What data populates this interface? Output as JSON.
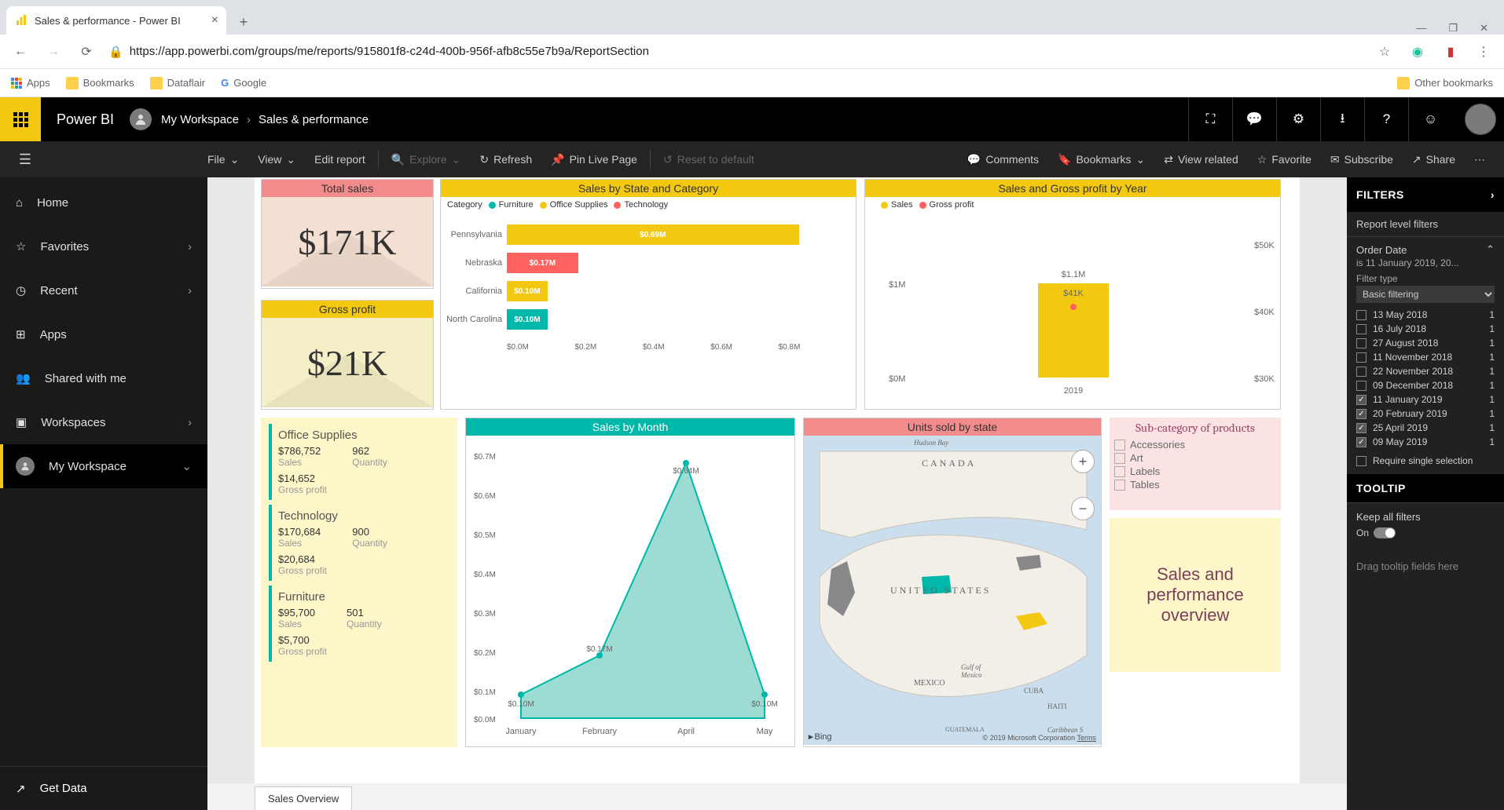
{
  "browser": {
    "tab_title": "Sales & performance - Power BI",
    "url": "https://app.powerbi.com/groups/me/reports/915801f8-c24d-400b-956f-afb8c55e7b9a/ReportSection",
    "bookmarks": [
      "Apps",
      "Bookmarks",
      "Dataflair",
      "Google"
    ],
    "other_bookmarks": "Other bookmarks"
  },
  "pbi": {
    "brand": "Power BI",
    "crumb_ws": "My Workspace",
    "crumb_report": "Sales & performance"
  },
  "toolbar": {
    "file": "File",
    "view": "View",
    "edit": "Edit report",
    "explore": "Explore",
    "refresh": "Refresh",
    "pin": "Pin Live Page",
    "reset": "Reset to default",
    "comments": "Comments",
    "bookmarks": "Bookmarks",
    "related": "View related",
    "favorite": "Favorite",
    "subscribe": "Subscribe",
    "share": "Share"
  },
  "sidebar": {
    "items": [
      "Home",
      "Favorites",
      "Recent",
      "Apps",
      "Shared with me",
      "Workspaces",
      "My Workspace"
    ],
    "get_data": "Get Data"
  },
  "visuals": {
    "total_sales": {
      "title": "Total sales",
      "value": "$171K"
    },
    "gross_profit": {
      "title": "Gross profit",
      "value": "$21K"
    },
    "sales_state_cat": {
      "title": "Sales by State and Category",
      "legend_label": "Category",
      "legend": [
        "Furniture",
        "Office Supplies",
        "Technology"
      ]
    },
    "sales_profit_year": {
      "title": "Sales and Gross profit by Year",
      "legend": [
        "Sales",
        "Gross profit"
      ]
    },
    "multirow": {
      "groups": [
        {
          "name": "Office Supplies",
          "sales": "$786,752",
          "qty": "962",
          "gp": "$14,652"
        },
        {
          "name": "Technology",
          "sales": "$170,684",
          "qty": "900",
          "gp": "$20,684"
        },
        {
          "name": "Furniture",
          "sales": "$95,700",
          "qty": "501",
          "gp": "$5,700"
        }
      ],
      "labels": {
        "sales": "Sales",
        "qty": "Quantity",
        "gp": "Gross profit"
      }
    },
    "sales_month": {
      "title": "Sales by Month"
    },
    "units_state": {
      "title": "Units sold by state",
      "canada": "CANADA",
      "us": "UNITED STATES",
      "mexico": "MEXICO",
      "gulf": "Gulf of\nMexico",
      "bing": "Bing",
      "copyright": "© 2019 Microsoft Corporation",
      "terms": "Terms",
      "hudson": "Hudson Bay",
      "cuba": "CUBA",
      "haiti": "HAITI",
      "guat": "GUATEMALA",
      "carib": "Caribbean S"
    },
    "subcat": {
      "title": "Sub-category of products",
      "items": [
        "Accessories",
        "Art",
        "Labels",
        "Tables"
      ]
    },
    "overview": {
      "line1": "Sales and",
      "line2": "performance",
      "line3": "overview"
    }
  },
  "report_tab": "Sales Overview",
  "filters": {
    "header": "FILTERS",
    "level": "Report level filters",
    "order_date": "Order Date",
    "order_date_sub": "is 11 January 2019, 20...",
    "filter_type_lbl": "Filter type",
    "filter_type": "Basic filtering",
    "dates": [
      {
        "d": "13 May 2018",
        "c": "1",
        "checked": false
      },
      {
        "d": "16 July 2018",
        "c": "1",
        "checked": false
      },
      {
        "d": "27 August 2018",
        "c": "1",
        "checked": false
      },
      {
        "d": "11 November 2018",
        "c": "1",
        "checked": false
      },
      {
        "d": "22 November 2018",
        "c": "1",
        "checked": false
      },
      {
        "d": "09 December 2018",
        "c": "1",
        "checked": false
      },
      {
        "d": "11 January 2019",
        "c": "1",
        "checked": true
      },
      {
        "d": "20 February 2019",
        "c": "1",
        "checked": true
      },
      {
        "d": "25 April 2019",
        "c": "1",
        "checked": true
      },
      {
        "d": "09 May 2019",
        "c": "1",
        "checked": true
      }
    ],
    "require_single": "Require single selection",
    "tooltip_header": "TOOLTIP",
    "keep_all": "Keep all filters",
    "on": "On",
    "drag": "Drag tooltip fields here"
  },
  "chart_data": [
    {
      "id": "sales_by_state_and_category",
      "type": "bar",
      "orientation": "horizontal",
      "stacked": true,
      "categories": [
        "Pennsylvania",
        "Nebraska",
        "California",
        "North Carolina"
      ],
      "series": [
        {
          "name": "Furniture",
          "color": "#00b8aa",
          "values": [
            0,
            0,
            0,
            0.1
          ]
        },
        {
          "name": "Office Supplies",
          "color": "#f2c811",
          "values": [
            0.69,
            0,
            0.1,
            0
          ]
        },
        {
          "name": "Technology",
          "color": "#fd625e",
          "values": [
            0,
            0.17,
            0,
            0
          ]
        }
      ],
      "data_labels": [
        "$0.69M",
        "$0.17M",
        "$0.10M",
        "$0.10M"
      ],
      "xlabel": "",
      "ylabel": "",
      "xlim": [
        0,
        0.8
      ],
      "x_ticks": [
        "$0.0M",
        "$0.2M",
        "$0.4M",
        "$0.6M",
        "$0.8M"
      ]
    },
    {
      "id": "sales_and_gross_profit_by_year",
      "type": "combo",
      "categories": [
        "2019"
      ],
      "series": [
        {
          "name": "Sales",
          "type": "column",
          "color": "#f2c811",
          "axis": "left",
          "values": [
            1.1
          ],
          "label": "$1.1M"
        },
        {
          "name": "Gross profit",
          "type": "line",
          "color": "#fd625e",
          "axis": "right",
          "values": [
            41
          ],
          "label": "$41K"
        }
      ],
      "y_left": {
        "range": [
          0,
          1.2
        ],
        "ticks": [
          "$0M",
          "$1M"
        ]
      },
      "y_right": {
        "range": [
          30,
          50
        ],
        "ticks": [
          "$30K",
          "$40K",
          "$50K"
        ]
      }
    },
    {
      "id": "sales_by_month",
      "type": "area",
      "color": "#7ed3c9",
      "x": [
        "January",
        "February",
        "April",
        "May"
      ],
      "y": [
        0.1,
        0.17,
        0.64,
        0.1
      ],
      "y_ticks": [
        "$0.0M",
        "$0.1M",
        "$0.2M",
        "$0.3M",
        "$0.4M",
        "$0.5M",
        "$0.6M",
        "$0.7M"
      ],
      "data_labels": [
        "$0.10M",
        "$0.17M",
        "$0.64M",
        "$0.10M"
      ],
      "ylim": [
        0,
        0.7
      ]
    }
  ]
}
